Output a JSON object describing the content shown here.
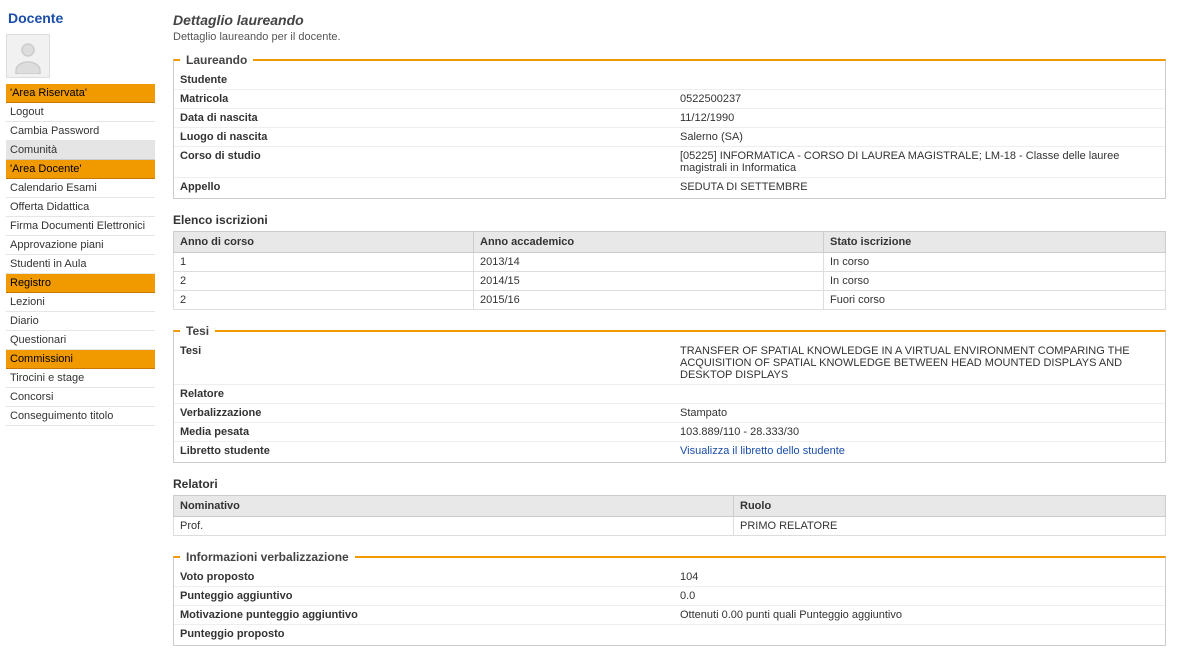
{
  "sidebar": {
    "title": "Docente",
    "username": "",
    "menu": [
      {
        "label": "'Area Riservata'",
        "type": "section"
      },
      {
        "label": "Logout",
        "type": "item"
      },
      {
        "label": "Cambia Password",
        "type": "item"
      },
      {
        "label": "Comunità",
        "type": "section-gray"
      },
      {
        "label": "'Area Docente'",
        "type": "section"
      },
      {
        "label": "Calendario Esami",
        "type": "item"
      },
      {
        "label": "Offerta Didattica",
        "type": "item"
      },
      {
        "label": "Firma Documenti Elettronici",
        "type": "item"
      },
      {
        "label": "Approvazione piani",
        "type": "item"
      },
      {
        "label": "Studenti in Aula",
        "type": "item"
      },
      {
        "label": "Registro",
        "type": "section"
      },
      {
        "label": "Lezioni",
        "type": "item"
      },
      {
        "label": "Diario",
        "type": "item"
      },
      {
        "label": "Questionari",
        "type": "item"
      },
      {
        "label": "Commissioni",
        "type": "section"
      },
      {
        "label": "Tirocini e stage",
        "type": "item"
      },
      {
        "label": "Concorsi",
        "type": "item"
      },
      {
        "label": "Conseguimento titolo",
        "type": "item"
      }
    ]
  },
  "main": {
    "title": "Dettaglio laureando",
    "subtitle": "Dettaglio laureando per il docente.",
    "laureando": {
      "legend": "Laureando",
      "rows": [
        {
          "k": "Studente",
          "v": ""
        },
        {
          "k": "Matricola",
          "v": "0522500237"
        },
        {
          "k": "Data di nascita",
          "v": "11/12/1990"
        },
        {
          "k": "Luogo di nascita",
          "v": "Salerno (SA)"
        },
        {
          "k": "Corso di studio",
          "v": "[05225] INFORMATICA - CORSO DI LAUREA MAGISTRALE; LM-18 - Classe delle lauree magistrali in Informatica"
        },
        {
          "k": "Appello",
          "v": "SEDUTA DI SETTEMBRE"
        }
      ]
    },
    "iscrizioni": {
      "heading": "Elenco iscrizioni",
      "headers": [
        "Anno di corso",
        "Anno accademico",
        "Stato iscrizione"
      ],
      "rows": [
        [
          "1",
          "2013/14",
          "In corso"
        ],
        [
          "2",
          "2014/15",
          "In corso"
        ],
        [
          "2",
          "2015/16",
          "Fuori corso"
        ]
      ]
    },
    "tesi": {
      "legend": "Tesi",
      "rows": [
        {
          "k": "Tesi",
          "v": "TRANSFER OF SPATIAL KNOWLEDGE IN A VIRTUAL ENVIRONMENT COMPARING THE ACQUISITION OF SPATIAL KNOWLEDGE BETWEEN HEAD MOUNTED DISPLAYS AND DESKTOP DISPLAYS"
        },
        {
          "k": "Relatore",
          "v": ""
        },
        {
          "k": "Verbalizzazione",
          "v": "Stampato"
        },
        {
          "k": "Media pesata",
          "v": "103.889/110 - 28.333/30"
        },
        {
          "k": "Libretto studente",
          "v": "Visualizza il libretto dello studente",
          "link": true
        }
      ]
    },
    "relatori": {
      "heading": "Relatori",
      "headers": [
        "Nominativo",
        "Ruolo"
      ],
      "rows": [
        [
          "Prof. ",
          "PRIMO RELATORE"
        ]
      ]
    },
    "verbalizzazione": {
      "legend": "Informazioni verbalizzazione",
      "rows": [
        {
          "k": "Voto proposto",
          "v": "104"
        },
        {
          "k": "Punteggio aggiuntivo",
          "v": "0.0"
        },
        {
          "k": "Motivazione punteggio aggiuntivo",
          "v": "Ottenuti 0.00 punti quali Punteggio aggiuntivo"
        },
        {
          "k": "Punteggio proposto",
          "v": ""
        }
      ]
    }
  }
}
